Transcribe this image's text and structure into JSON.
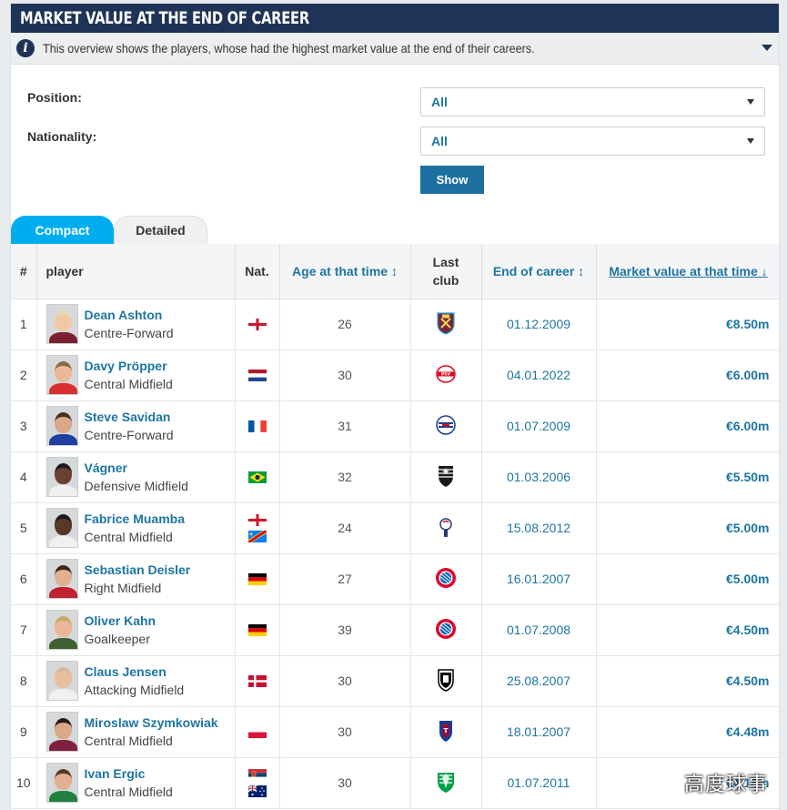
{
  "header": {
    "title": "MARKET VALUE AT THE END OF CAREER"
  },
  "info": {
    "text": "This overview shows the players, whose had the highest market value at the end of their careers."
  },
  "filters": {
    "position_label": "Position:",
    "position_value": "All",
    "nationality_label": "Nationality:",
    "nationality_value": "All",
    "show_label": "Show"
  },
  "tabs": {
    "compact": "Compact",
    "detailed": "Detailed"
  },
  "columns": {
    "rank": "#",
    "player": "player",
    "nat": "Nat.",
    "age": "Age at that time ↕",
    "club_line1": "Last",
    "club_line2": "club",
    "end": "End of career ↕",
    "mv": "Market value at that time ↓"
  },
  "rows": [
    {
      "rank": "1",
      "name": "Dean Ashton",
      "position": "Centre-Forward",
      "age": "26",
      "end": "01.12.2009",
      "mv": "€8.50m",
      "flags": [
        "england"
      ],
      "club": "west-ham-crest",
      "hair": "#e8d9b0",
      "skin": "#f0c8a8",
      "shirt": "#7a2030"
    },
    {
      "rank": "2",
      "name": "Davy Pröpper",
      "position": "Central Midfield",
      "age": "30",
      "end": "04.01.2022",
      "mv": "€6.00m",
      "flags": [
        "netherlands"
      ],
      "club": "psv-crest",
      "hair": "#8a6a40",
      "skin": "#e8b898",
      "shirt": "#d83030"
    },
    {
      "rank": "3",
      "name": "Steve Savidan",
      "position": "Centre-Forward",
      "age": "31",
      "end": "01.07.2009",
      "mv": "€6.00m",
      "flags": [
        "france"
      ],
      "club": "caen-crest",
      "hair": "#4a3020",
      "skin": "#d8a888",
      "shirt": "#2040a0"
    },
    {
      "rank": "4",
      "name": "Vágner",
      "position": "Defensive Midfield",
      "age": "32",
      "end": "01.03.2006",
      "mv": "€5.50m",
      "flags": [
        "brazil"
      ],
      "club": "atletico-mineiro-crest",
      "hair": "#1a1a1a",
      "skin": "#6a4030",
      "shirt": "#f0f0f0"
    },
    {
      "rank": "5",
      "name": "Fabrice Muamba",
      "position": "Central Midfield",
      "age": "24",
      "end": "15.08.2012",
      "mv": "€5.00m",
      "flags": [
        "england",
        "dr-congo"
      ],
      "club": "bolton-crest",
      "hair": "#1a1a1a",
      "skin": "#5a3828",
      "shirt": "#f0f0f0"
    },
    {
      "rank": "6",
      "name": "Sebastian Deisler",
      "position": "Right Midfield",
      "age": "27",
      "end": "16.01.2007",
      "mv": "€5.00m",
      "flags": [
        "germany"
      ],
      "club": "bayern-crest",
      "hair": "#3a2818",
      "skin": "#e0b090",
      "shirt": "#c02030"
    },
    {
      "rank": "7",
      "name": "Oliver Kahn",
      "position": "Goalkeeper",
      "age": "39",
      "end": "01.07.2008",
      "mv": "€4.50m",
      "flags": [
        "germany"
      ],
      "club": "bayern-crest",
      "hair": "#c8a868",
      "skin": "#e8b898",
      "shirt": "#406030"
    },
    {
      "rank": "8",
      "name": "Claus Jensen",
      "position": "Attacking Midfield",
      "age": "30",
      "end": "25.08.2007",
      "mv": "€4.50m",
      "flags": [
        "denmark"
      ],
      "club": "fulham-crest",
      "hair": "#d8b8a0",
      "skin": "#e8c0a0",
      "shirt": "#f0f0f0"
    },
    {
      "rank": "9",
      "name": "Miroslaw Szymkowiak",
      "position": "Central Midfield",
      "age": "30",
      "end": "18.01.2007",
      "mv": "€4.48m",
      "flags": [
        "poland"
      ],
      "club": "trabzonspor-crest",
      "hair": "#2a1a10",
      "skin": "#d8a888",
      "shirt": "#802040"
    },
    {
      "rank": "10",
      "name": "Ivan Ergic",
      "position": "Central Midfield",
      "age": "30",
      "end": "01.07.2011",
      "mv": "€4.18m",
      "flags": [
        "serbia",
        "australia"
      ],
      "club": "bursaspor-crest",
      "hair": "#5a3a20",
      "skin": "#e0b090",
      "shirt": "#208040"
    }
  ],
  "watermark": "高度球事"
}
